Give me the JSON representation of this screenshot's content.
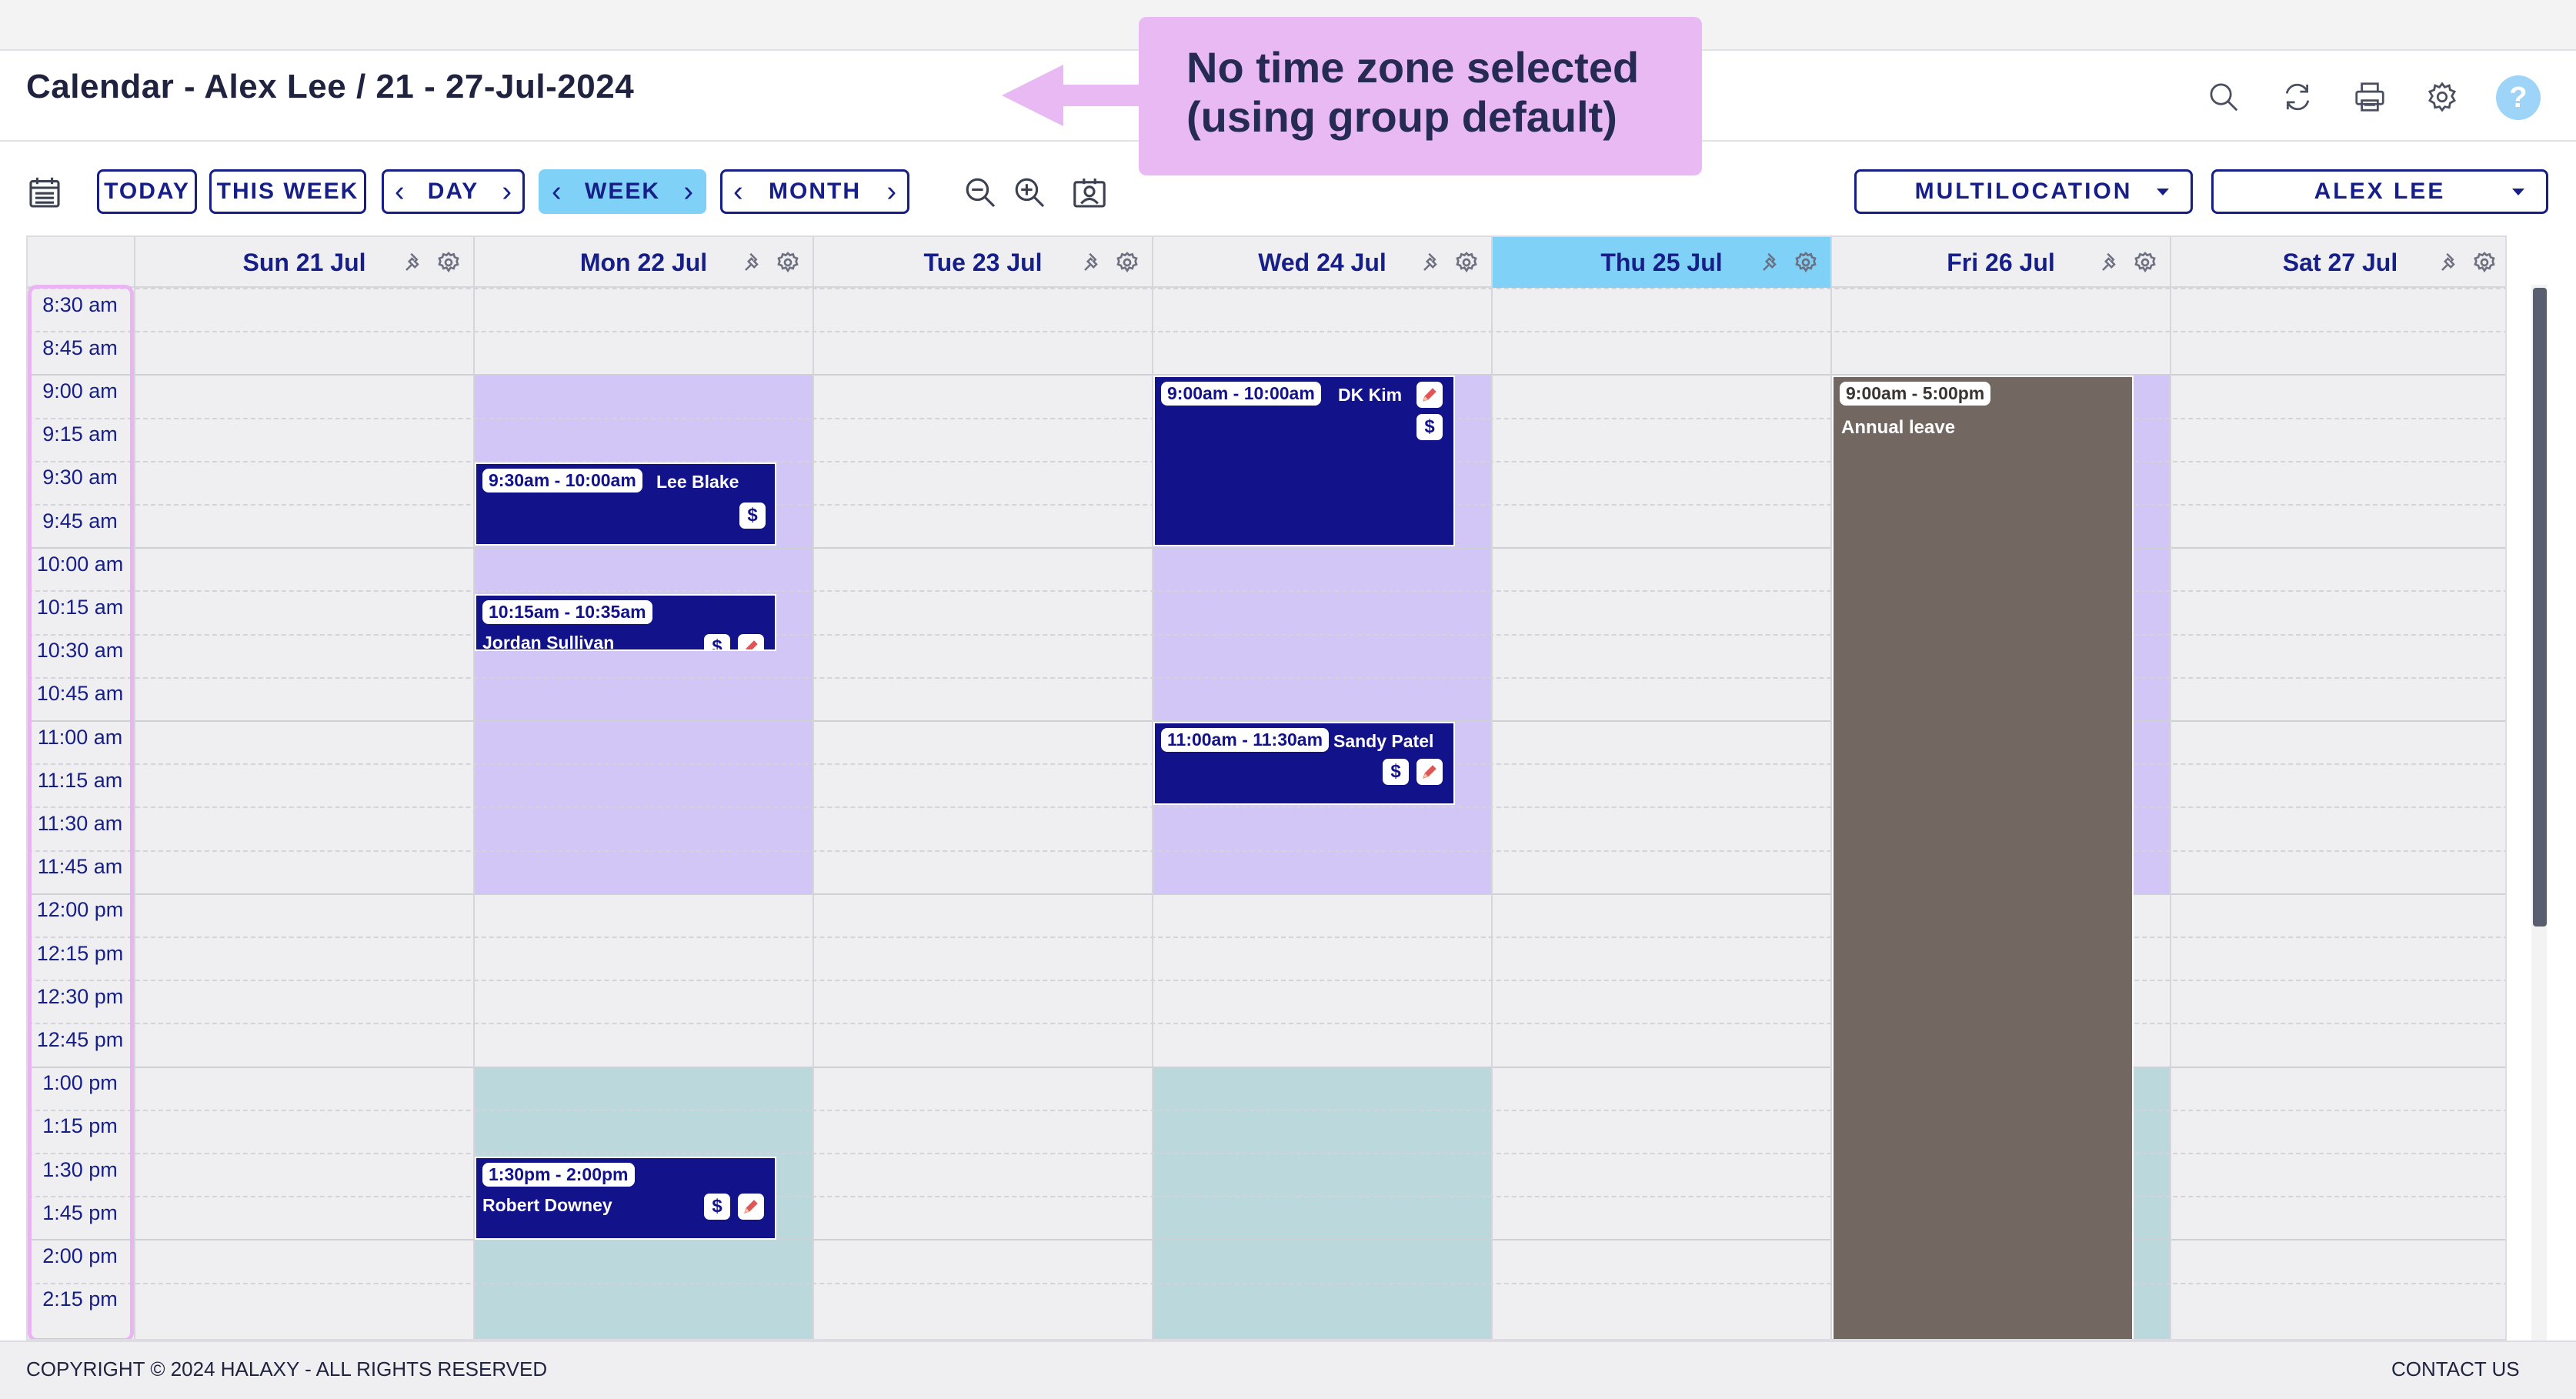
{
  "header": {
    "title": "Calendar - Alex Lee / 21 - 27-Jul-2024",
    "icons": [
      "search-icon",
      "refresh-icon",
      "print-icon",
      "gear-icon",
      "help-icon"
    ],
    "help_label": "?"
  },
  "callout": {
    "text": "No time zone selected\n(using group default)",
    "color": "#e9b9f4"
  },
  "toolbar": {
    "today": "TODAY",
    "this_week": "THIS WEEK",
    "day": "DAY",
    "week": "WEEK",
    "month": "MONTH",
    "prev": "‹",
    "next": "›",
    "location_select": "MULTILOCATION",
    "practitioner_select": "ALEX LEE",
    "accent": "#7fd1f7"
  },
  "days": [
    {
      "label": "Sun 21 Jul",
      "today": false
    },
    {
      "label": "Mon 22 Jul",
      "today": false
    },
    {
      "label": "Tue 23 Jul",
      "today": false
    },
    {
      "label": "Wed 24 Jul",
      "today": false
    },
    {
      "label": "Thu 25 Jul",
      "today": true
    },
    {
      "label": "Fri 26 Jul",
      "today": false
    },
    {
      "label": "Sat 27 Jul",
      "today": false
    }
  ],
  "times": [
    "8:30 am",
    "8:45 am",
    "9:00 am",
    "9:15 am",
    "9:30 am",
    "9:45 am",
    "10:00 am",
    "10:15 am",
    "10:30 am",
    "10:45 am",
    "11:00 am",
    "11:15 am",
    "11:30 am",
    "11:45 am",
    "12:00 pm",
    "12:15 pm",
    "12:30 pm",
    "12:45 pm",
    "1:00 pm",
    "1:15 pm",
    "1:30 pm",
    "1:45 pm",
    "2:00 pm",
    "2:15 pm"
  ],
  "appointments": [
    {
      "time": "9:30am - 10:00am",
      "name": "Lee Blake",
      "day": "Mon 22 Jul"
    },
    {
      "time": "10:15am - 10:35am",
      "name": "Jordan Sullivan",
      "day": "Mon 22 Jul"
    },
    {
      "time": "1:30pm - 2:00pm",
      "name": "Robert Downey",
      "day": "Mon 22 Jul"
    },
    {
      "time": "9:00am - 10:00am",
      "name": "DK Kim",
      "day": "Wed 24 Jul"
    },
    {
      "time": "11:00am - 11:30am",
      "name": "Sandy Patel",
      "day": "Wed 24 Jul"
    }
  ],
  "leave": {
    "time": "9:00am - 5:00pm",
    "note": "Annual leave",
    "day": "Fri 26 Jul"
  },
  "badges": {
    "billing": "$"
  },
  "colors": {
    "appointment": "#12128a",
    "available": "#d2c6f6",
    "teal_block": "#bbd8dc",
    "leave": "#726861",
    "today_header": "#7fd1f7"
  },
  "footer": {
    "copyright": "COPYRIGHT © 2024 HALAXY - ALL RIGHTS RESERVED",
    "contact": "CONTACT US"
  }
}
